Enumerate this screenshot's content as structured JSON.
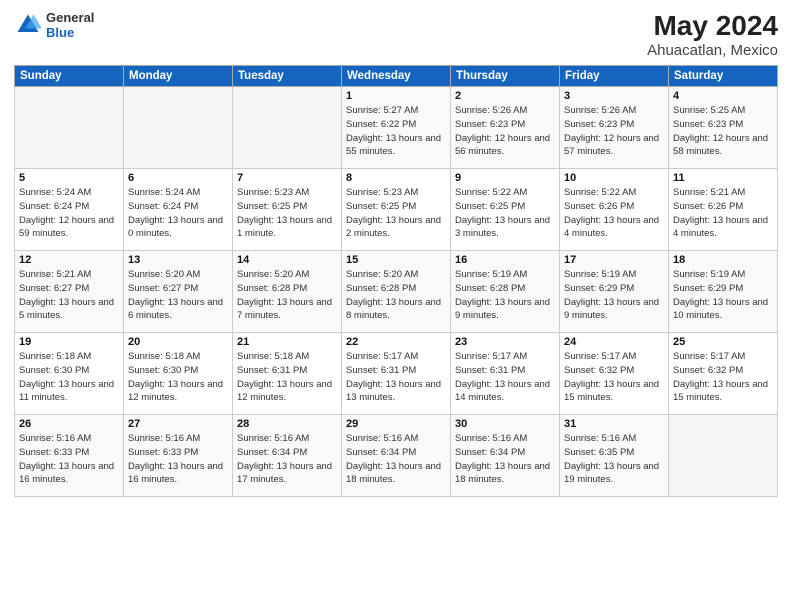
{
  "header": {
    "logo_general": "General",
    "logo_blue": "Blue",
    "title": "May 2024",
    "subtitle": "Ahuacatlan, Mexico"
  },
  "days_of_week": [
    "Sunday",
    "Monday",
    "Tuesday",
    "Wednesday",
    "Thursday",
    "Friday",
    "Saturday"
  ],
  "weeks": [
    [
      {
        "day": "",
        "sunrise": "",
        "sunset": "",
        "daylight": "",
        "empty": true
      },
      {
        "day": "",
        "sunrise": "",
        "sunset": "",
        "daylight": "",
        "empty": true
      },
      {
        "day": "",
        "sunrise": "",
        "sunset": "",
        "daylight": "",
        "empty": true
      },
      {
        "day": "1",
        "sunrise": "Sunrise: 5:27 AM",
        "sunset": "Sunset: 6:22 PM",
        "daylight": "Daylight: 13 hours and 55 minutes."
      },
      {
        "day": "2",
        "sunrise": "Sunrise: 5:26 AM",
        "sunset": "Sunset: 6:23 PM",
        "daylight": "Daylight: 12 hours and 56 minutes."
      },
      {
        "day": "3",
        "sunrise": "Sunrise: 5:26 AM",
        "sunset": "Sunset: 6:23 PM",
        "daylight": "Daylight: 12 hours and 57 minutes."
      },
      {
        "day": "4",
        "sunrise": "Sunrise: 5:25 AM",
        "sunset": "Sunset: 6:23 PM",
        "daylight": "Daylight: 12 hours and 58 minutes."
      }
    ],
    [
      {
        "day": "5",
        "sunrise": "Sunrise: 5:24 AM",
        "sunset": "Sunset: 6:24 PM",
        "daylight": "Daylight: 12 hours and 59 minutes."
      },
      {
        "day": "6",
        "sunrise": "Sunrise: 5:24 AM",
        "sunset": "Sunset: 6:24 PM",
        "daylight": "Daylight: 13 hours and 0 minutes."
      },
      {
        "day": "7",
        "sunrise": "Sunrise: 5:23 AM",
        "sunset": "Sunset: 6:25 PM",
        "daylight": "Daylight: 13 hours and 1 minute."
      },
      {
        "day": "8",
        "sunrise": "Sunrise: 5:23 AM",
        "sunset": "Sunset: 6:25 PM",
        "daylight": "Daylight: 13 hours and 2 minutes."
      },
      {
        "day": "9",
        "sunrise": "Sunrise: 5:22 AM",
        "sunset": "Sunset: 6:25 PM",
        "daylight": "Daylight: 13 hours and 3 minutes."
      },
      {
        "day": "10",
        "sunrise": "Sunrise: 5:22 AM",
        "sunset": "Sunset: 6:26 PM",
        "daylight": "Daylight: 13 hours and 4 minutes."
      },
      {
        "day": "11",
        "sunrise": "Sunrise: 5:21 AM",
        "sunset": "Sunset: 6:26 PM",
        "daylight": "Daylight: 13 hours and 4 minutes."
      }
    ],
    [
      {
        "day": "12",
        "sunrise": "Sunrise: 5:21 AM",
        "sunset": "Sunset: 6:27 PM",
        "daylight": "Daylight: 13 hours and 5 minutes."
      },
      {
        "day": "13",
        "sunrise": "Sunrise: 5:20 AM",
        "sunset": "Sunset: 6:27 PM",
        "daylight": "Daylight: 13 hours and 6 minutes."
      },
      {
        "day": "14",
        "sunrise": "Sunrise: 5:20 AM",
        "sunset": "Sunset: 6:28 PM",
        "daylight": "Daylight: 13 hours and 7 minutes."
      },
      {
        "day": "15",
        "sunrise": "Sunrise: 5:20 AM",
        "sunset": "Sunset: 6:28 PM",
        "daylight": "Daylight: 13 hours and 8 minutes."
      },
      {
        "day": "16",
        "sunrise": "Sunrise: 5:19 AM",
        "sunset": "Sunset: 6:28 PM",
        "daylight": "Daylight: 13 hours and 9 minutes."
      },
      {
        "day": "17",
        "sunrise": "Sunrise: 5:19 AM",
        "sunset": "Sunset: 6:29 PM",
        "daylight": "Daylight: 13 hours and 9 minutes."
      },
      {
        "day": "18",
        "sunrise": "Sunrise: 5:19 AM",
        "sunset": "Sunset: 6:29 PM",
        "daylight": "Daylight: 13 hours and 10 minutes."
      }
    ],
    [
      {
        "day": "19",
        "sunrise": "Sunrise: 5:18 AM",
        "sunset": "Sunset: 6:30 PM",
        "daylight": "Daylight: 13 hours and 11 minutes."
      },
      {
        "day": "20",
        "sunrise": "Sunrise: 5:18 AM",
        "sunset": "Sunset: 6:30 PM",
        "daylight": "Daylight: 13 hours and 12 minutes."
      },
      {
        "day": "21",
        "sunrise": "Sunrise: 5:18 AM",
        "sunset": "Sunset: 6:31 PM",
        "daylight": "Daylight: 13 hours and 12 minutes."
      },
      {
        "day": "22",
        "sunrise": "Sunrise: 5:17 AM",
        "sunset": "Sunset: 6:31 PM",
        "daylight": "Daylight: 13 hours and 13 minutes."
      },
      {
        "day": "23",
        "sunrise": "Sunrise: 5:17 AM",
        "sunset": "Sunset: 6:31 PM",
        "daylight": "Daylight: 13 hours and 14 minutes."
      },
      {
        "day": "24",
        "sunrise": "Sunrise: 5:17 AM",
        "sunset": "Sunset: 6:32 PM",
        "daylight": "Daylight: 13 hours and 15 minutes."
      },
      {
        "day": "25",
        "sunrise": "Sunrise: 5:17 AM",
        "sunset": "Sunset: 6:32 PM",
        "daylight": "Daylight: 13 hours and 15 minutes."
      }
    ],
    [
      {
        "day": "26",
        "sunrise": "Sunrise: 5:16 AM",
        "sunset": "Sunset: 6:33 PM",
        "daylight": "Daylight: 13 hours and 16 minutes."
      },
      {
        "day": "27",
        "sunrise": "Sunrise: 5:16 AM",
        "sunset": "Sunset: 6:33 PM",
        "daylight": "Daylight: 13 hours and 16 minutes."
      },
      {
        "day": "28",
        "sunrise": "Sunrise: 5:16 AM",
        "sunset": "Sunset: 6:34 PM",
        "daylight": "Daylight: 13 hours and 17 minutes."
      },
      {
        "day": "29",
        "sunrise": "Sunrise: 5:16 AM",
        "sunset": "Sunset: 6:34 PM",
        "daylight": "Daylight: 13 hours and 18 minutes."
      },
      {
        "day": "30",
        "sunrise": "Sunrise: 5:16 AM",
        "sunset": "Sunset: 6:34 PM",
        "daylight": "Daylight: 13 hours and 18 minutes."
      },
      {
        "day": "31",
        "sunrise": "Sunrise: 5:16 AM",
        "sunset": "Sunset: 6:35 PM",
        "daylight": "Daylight: 13 hours and 19 minutes."
      },
      {
        "day": "",
        "sunrise": "",
        "sunset": "",
        "daylight": "",
        "empty": true
      }
    ]
  ]
}
